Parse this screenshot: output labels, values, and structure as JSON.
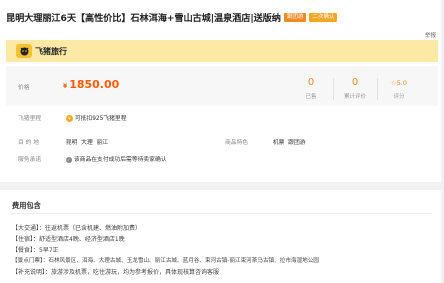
{
  "title": "昆明大理丽江6天【高性价比】石林洱海+雪山古城|温泉酒店|送版纳",
  "badges": [
    "跟团游",
    "二次确认"
  ],
  "colors": {
    "accent": "#ff5a00",
    "banner": "#fce9a6",
    "badge_orange": "#f08a24",
    "badge_yellow": "#f5a623"
  },
  "report_label": "举报",
  "brand": {
    "icon": "pig-logo-icon",
    "name": "飞猪旅行"
  },
  "price": {
    "label": "价格",
    "currency": "¥",
    "value": "1850.00"
  },
  "stats": [
    {
      "value": "0",
      "caption": "已售"
    },
    {
      "value": "0",
      "caption": "累计评价"
    }
  ],
  "score": {
    "value": "5.0",
    "caption": "评分",
    "icon": "star-icon"
  },
  "points": {
    "label": "飞猪里程",
    "value": "可抵扣925飞猪里程",
    "icon": "coin-icon"
  },
  "destination": {
    "label": "目 的 地",
    "values": [
      "昆明",
      "大理",
      "丽江"
    ]
  },
  "features": {
    "label": "商品特色",
    "values": [
      "机票",
      "跟团游"
    ]
  },
  "service": {
    "label": "服务承诺",
    "value": "该商品在支付成功后需等待卖家确认",
    "icon": "check-circle-icon"
  },
  "section": {
    "title": "费用包含",
    "items": [
      "【大交通】：往返机票（已含机建、燃油附加费）",
      "【住宿】：舒适型酒店4晚、经济型酒店1晚",
      "【餐食】：5早7正",
      "【景点门票】：石林风景区、洱海、大理古城、玉龙雪山、丽江古城、蓝月谷、束河古镇-丽江束河茶马古镇、拉市海湿地公园",
      "【补充说明】：旅游涉及机票，吃住游玩，均为参考报价，具体现核算咨询客服"
    ]
  }
}
